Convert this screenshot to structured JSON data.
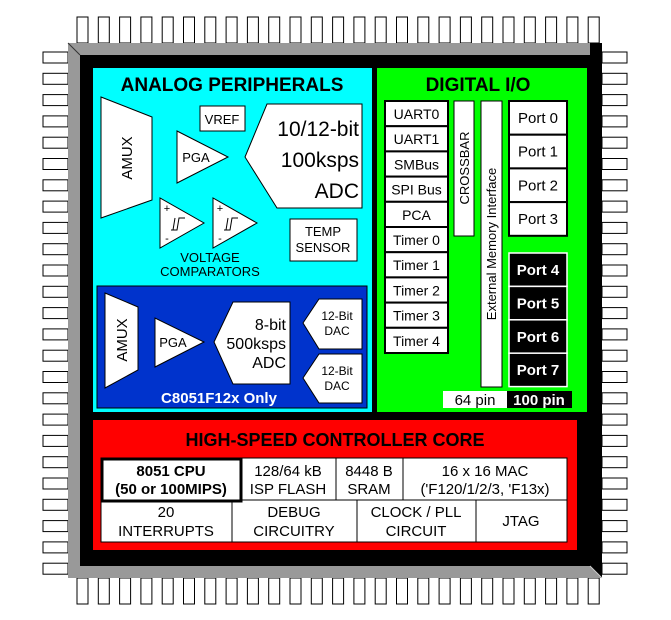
{
  "colors": {
    "analog": "#00ffff",
    "digital": "#00ff00",
    "core": "#ff0000",
    "subpanel": "#0033cc",
    "package": "#999999",
    "die": "#000000"
  },
  "analog": {
    "title": "ANALOG PERIPHERALS",
    "amux": "AMUX",
    "vref": "VREF",
    "pga": "PGA",
    "adc": [
      "10/12-bit",
      "100ksps",
      "ADC"
    ],
    "comparators": [
      "VOLTAGE",
      "COMPARATORS"
    ],
    "comparator_signs": [
      "+",
      "-"
    ],
    "temp": [
      "TEMP",
      "SENSOR"
    ],
    "sub": {
      "amux": "AMUX",
      "pga": "PGA",
      "adc": [
        "8-bit",
        "500ksps",
        "ADC"
      ],
      "dac1": [
        "12-Bit",
        "DAC"
      ],
      "dac2": [
        "12-Bit",
        "DAC"
      ],
      "label": "C8051F12x Only"
    }
  },
  "digital": {
    "title": "DIGITAL I/O",
    "peripherals": [
      "UART0",
      "UART1",
      "SMBus",
      "SPI Bus",
      "PCA",
      "Timer 0",
      "Timer 1",
      "Timer 2",
      "Timer 3",
      "Timer 4"
    ],
    "crossbar": "CROSSBAR",
    "emif": "External Memory Interface",
    "ports_64": [
      "Port 0",
      "Port 1",
      "Port 2",
      "Port 3"
    ],
    "ports_100": [
      "Port 4",
      "Port 5",
      "Port 6",
      "Port 7"
    ],
    "pin64": "64 pin",
    "pin100": "100 pin"
  },
  "core": {
    "title": "HIGH-SPEED CONTROLLER CORE",
    "cpu": [
      "8051 CPU",
      "(50 or 100MIPS)"
    ],
    "flash": [
      "128/64 kB",
      "ISP FLASH"
    ],
    "sram": [
      "8448 B",
      "SRAM"
    ],
    "mac": [
      "16 x 16 MAC",
      "('F120/1/2/3, 'F13x)"
    ],
    "interrupts": [
      "20",
      "INTERRUPTS"
    ],
    "debug": [
      "DEBUG",
      "CIRCUITRY"
    ],
    "clock": [
      "CLOCK / PLL",
      "CIRCUIT"
    ],
    "jtag": "JTAG"
  }
}
